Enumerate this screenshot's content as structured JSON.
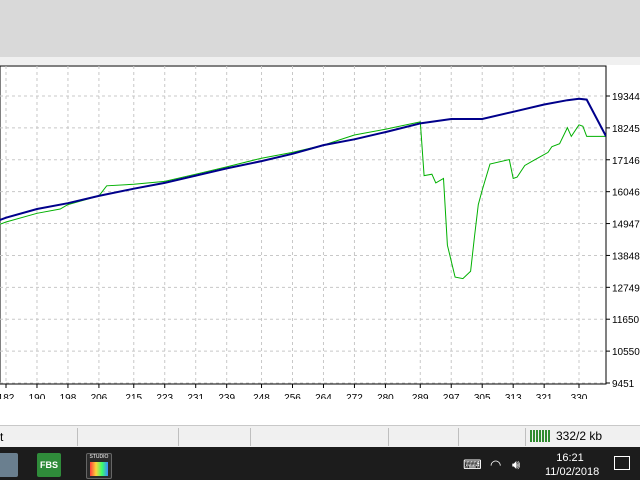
{
  "status": {
    "left_text": "t",
    "traffic": "332/2 kb"
  },
  "taskbar": {
    "fbs_label": "FBS",
    "studio_label": "STUDIO",
    "time": "16:21",
    "date": "11/02/2018"
  },
  "colors": {
    "balance_line": "#00008b",
    "equity_line": "#00b000",
    "grid": "#c8c8c8"
  },
  "chart_data": {
    "type": "line",
    "title": "",
    "xlabel": "",
    "ylabel": "",
    "x_ticks": [
      182,
      190,
      198,
      206,
      215,
      223,
      231,
      239,
      248,
      256,
      264,
      272,
      280,
      289,
      297,
      305,
      313,
      321,
      330
    ],
    "y_ticks": [
      9451,
      10550,
      11650,
      12749,
      13848,
      14947,
      16046,
      17146,
      18245,
      19344
    ],
    "xlim": [
      182,
      337
    ],
    "ylim": [
      9451,
      19344
    ],
    "grid": true,
    "series": [
      {
        "color": "#00008b",
        "x": [
          177,
          182,
          190,
          198,
          206,
          215,
          223,
          231,
          239,
          248,
          256,
          264,
          272,
          280,
          289,
          297,
          305,
          313,
          321,
          327,
          330,
          332,
          337
        ],
        "y": [
          14900,
          15150,
          15450,
          15650,
          15900,
          16150,
          16350,
          16600,
          16850,
          17100,
          17350,
          17650,
          17850,
          18100,
          18400,
          18550,
          18550,
          18800,
          19050,
          19200,
          19250,
          19220,
          17950
        ]
      },
      {
        "color": "#00b000",
        "x": [
          177,
          182,
          190,
          196,
          198,
          206,
          208,
          215,
          223,
          231,
          239,
          248,
          256,
          264,
          272,
          280,
          289,
          290,
          292,
          293,
          295,
          296,
          298,
          300,
          302,
          303,
          304,
          305,
          307,
          312,
          313,
          314,
          316,
          318,
          320,
          322,
          323,
          325,
          327,
          328,
          330,
          331,
          332,
          337
        ],
        "y": [
          14750,
          15000,
          15300,
          15450,
          15600,
          15900,
          16250,
          16300,
          16400,
          16650,
          16900,
          17200,
          17400,
          17650,
          18000,
          18200,
          18450,
          16600,
          16650,
          16350,
          16500,
          14200,
          13100,
          13050,
          13300,
          14500,
          15600,
          16100,
          17000,
          17150,
          16500,
          16550,
          16950,
          17100,
          17250,
          17400,
          17600,
          17700,
          18250,
          17950,
          18350,
          18300,
          17950,
          17950
        ]
      }
    ]
  }
}
